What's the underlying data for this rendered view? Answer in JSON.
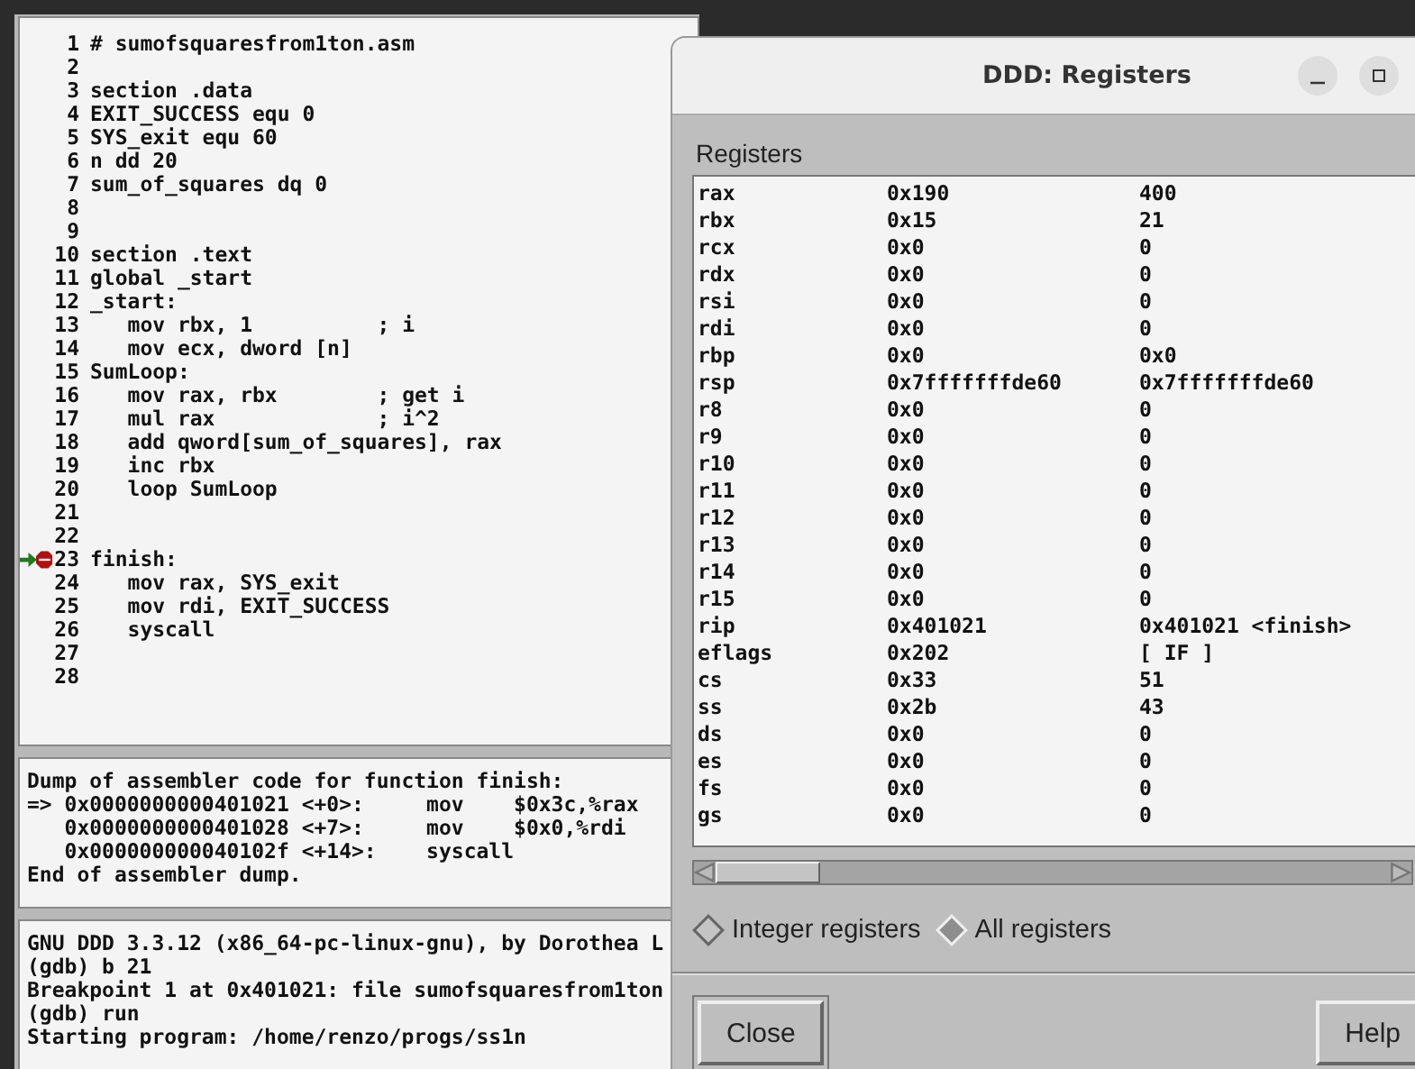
{
  "source": {
    "lines": [
      {
        "number": "1",
        "text": "# sumofsquaresfrom1ton.asm",
        "breakpoint": false,
        "current": false
      },
      {
        "number": "2",
        "breakpoint": false,
        "current": false
      },
      {
        "number": "3",
        "text": "section .data",
        "breakpoint": false,
        "current": false
      },
      {
        "number": "4",
        "text": "EXIT_SUCCESS equ 0",
        "breakpoint": false,
        "current": false
      },
      {
        "number": "5",
        "text": "SYS_exit equ 60",
        "breakpoint": false,
        "current": false
      },
      {
        "number": "6",
        "text": "n dd 20",
        "breakpoint": false,
        "current": false
      },
      {
        "number": "7",
        "text": "sum_of_squares dq 0",
        "breakpoint": false,
        "current": false
      },
      {
        "number": "8",
        "breakpoint": false,
        "current": false
      },
      {
        "number": "9",
        "breakpoint": false,
        "current": false
      },
      {
        "number": "10",
        "text": "section .text",
        "breakpoint": false,
        "current": false
      },
      {
        "number": "11",
        "text": "global _start",
        "breakpoint": false,
        "current": false
      },
      {
        "number": "12",
        "text": "_start:",
        "breakpoint": false,
        "current": false
      },
      {
        "number": "13",
        "text": "   mov rbx, 1          ; i",
        "breakpoint": false,
        "current": false
      },
      {
        "number": "14",
        "text": "   mov ecx, dword [n]",
        "breakpoint": false,
        "current": false
      },
      {
        "number": "15",
        "text": "SumLoop:",
        "breakpoint": false,
        "current": false
      },
      {
        "number": "16",
        "text": "   mov rax, rbx        ; get i",
        "breakpoint": false,
        "current": false
      },
      {
        "number": "17",
        "text": "   mul rax             ; i^2",
        "breakpoint": false,
        "current": false
      },
      {
        "number": "18",
        "text": "   add qword[sum_of_squares], rax",
        "breakpoint": false,
        "current": false
      },
      {
        "number": "19",
        "text": "   inc rbx",
        "breakpoint": false,
        "current": false
      },
      {
        "number": "20",
        "text": "   loop SumLoop",
        "breakpoint": false,
        "current": false
      },
      {
        "number": "21",
        "breakpoint": false,
        "current": false
      },
      {
        "number": "22",
        "breakpoint": false,
        "current": false
      },
      {
        "number": "23",
        "text": "finish:",
        "breakpoint": true,
        "current": true
      },
      {
        "number": "24",
        "text": "   mov rax, SYS_exit",
        "breakpoint": false,
        "current": false
      },
      {
        "number": "25",
        "text": "   mov rdi, EXIT_SUCCESS",
        "breakpoint": false,
        "current": false
      },
      {
        "number": "26",
        "text": "   syscall",
        "breakpoint": false,
        "current": false
      },
      {
        "number": "27",
        "breakpoint": false,
        "current": false
      },
      {
        "number": "28",
        "breakpoint": false,
        "current": false
      }
    ]
  },
  "dump": {
    "lines": [
      "Dump of assembler code for function finish:",
      "=> 0x0000000000401021 <+0>:     mov    $0x3c,%rax",
      "   0x0000000000401028 <+7>:     mov    $0x0,%rdi",
      "   0x000000000040102f <+14>:    syscall",
      "End of assembler dump."
    ]
  },
  "console": {
    "lines": [
      "GNU DDD 3.3.12 (x86_64-pc-linux-gnu), by Dorothea L",
      "(gdb) b 21",
      "Breakpoint 1 at 0x401021: file sumofsquaresfrom1ton",
      "(gdb) run",
      "Starting program: /home/renzo/progs/ss1n"
    ]
  },
  "registers_window": {
    "title": "DDD: Registers",
    "label": "Registers",
    "rows": [
      {
        "name": "rax",
        "raw": "0x190",
        "natural": "400"
      },
      {
        "name": "rbx",
        "raw": "0x15",
        "natural": "21"
      },
      {
        "name": "rcx",
        "raw": "0x0",
        "natural": "0"
      },
      {
        "name": "rdx",
        "raw": "0x0",
        "natural": "0"
      },
      {
        "name": "rsi",
        "raw": "0x0",
        "natural": "0"
      },
      {
        "name": "rdi",
        "raw": "0x0",
        "natural": "0"
      },
      {
        "name": "rbp",
        "raw": "0x0",
        "natural": "0x0"
      },
      {
        "name": "rsp",
        "raw": "0x7fffffffde60",
        "natural": "0x7fffffffde60"
      },
      {
        "name": "r8",
        "raw": "0x0",
        "natural": "0"
      },
      {
        "name": "r9",
        "raw": "0x0",
        "natural": "0"
      },
      {
        "name": "r10",
        "raw": "0x0",
        "natural": "0"
      },
      {
        "name": "r11",
        "raw": "0x0",
        "natural": "0"
      },
      {
        "name": "r12",
        "raw": "0x0",
        "natural": "0"
      },
      {
        "name": "r13",
        "raw": "0x0",
        "natural": "0"
      },
      {
        "name": "r14",
        "raw": "0x0",
        "natural": "0"
      },
      {
        "name": "r15",
        "raw": "0x0",
        "natural": "0"
      },
      {
        "name": "rip",
        "raw": "0x401021",
        "natural": "0x401021 <finish>"
      },
      {
        "name": "eflags",
        "raw": "0x202",
        "natural": "[ IF ]"
      },
      {
        "name": "cs",
        "raw": "0x33",
        "natural": "51"
      },
      {
        "name": "ss",
        "raw": "0x2b",
        "natural": "43"
      },
      {
        "name": "ds",
        "raw": "0x0",
        "natural": "0"
      },
      {
        "name": "es",
        "raw": "0x0",
        "natural": "0"
      },
      {
        "name": "fs",
        "raw": "0x0",
        "natural": "0"
      },
      {
        "name": "gs",
        "raw": "0x0",
        "natural": "0"
      }
    ],
    "options": [
      {
        "label": "Integer registers",
        "selected": false
      },
      {
        "label": "All registers",
        "selected": true
      }
    ],
    "buttons": [
      "Close",
      "Help"
    ]
  }
}
